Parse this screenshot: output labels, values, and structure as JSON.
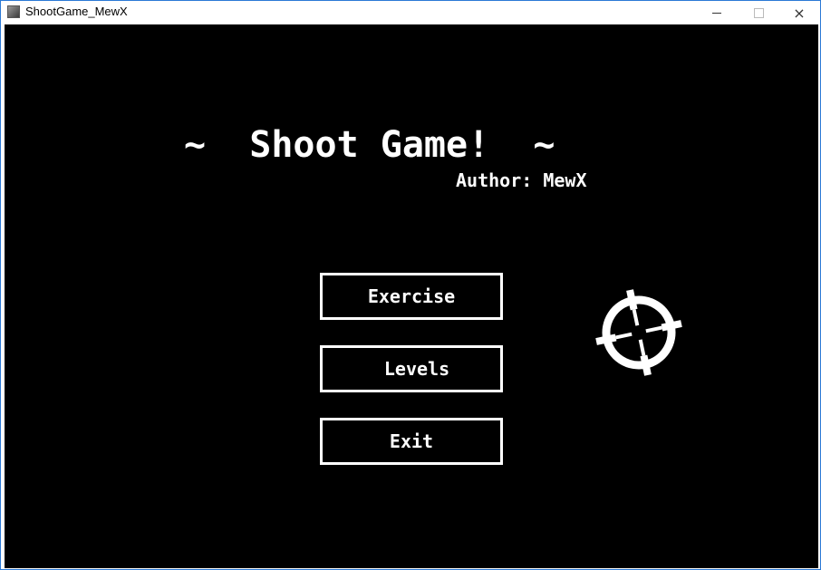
{
  "window": {
    "title": "ShootGame_MewX",
    "controls": {
      "minimize": "minimize",
      "maximize": "maximize",
      "close": "×"
    }
  },
  "game": {
    "title": "~  Shoot Game!  ~",
    "author": "Author: MewX",
    "menu": [
      {
        "label": "Exercise"
      },
      {
        "label": " Levels"
      },
      {
        "label": "Exit"
      }
    ],
    "cursor_icon": "crosshair-icon"
  },
  "colors": {
    "background": "#000000",
    "foreground": "#ffffff",
    "window_border": "#2b79d6"
  }
}
